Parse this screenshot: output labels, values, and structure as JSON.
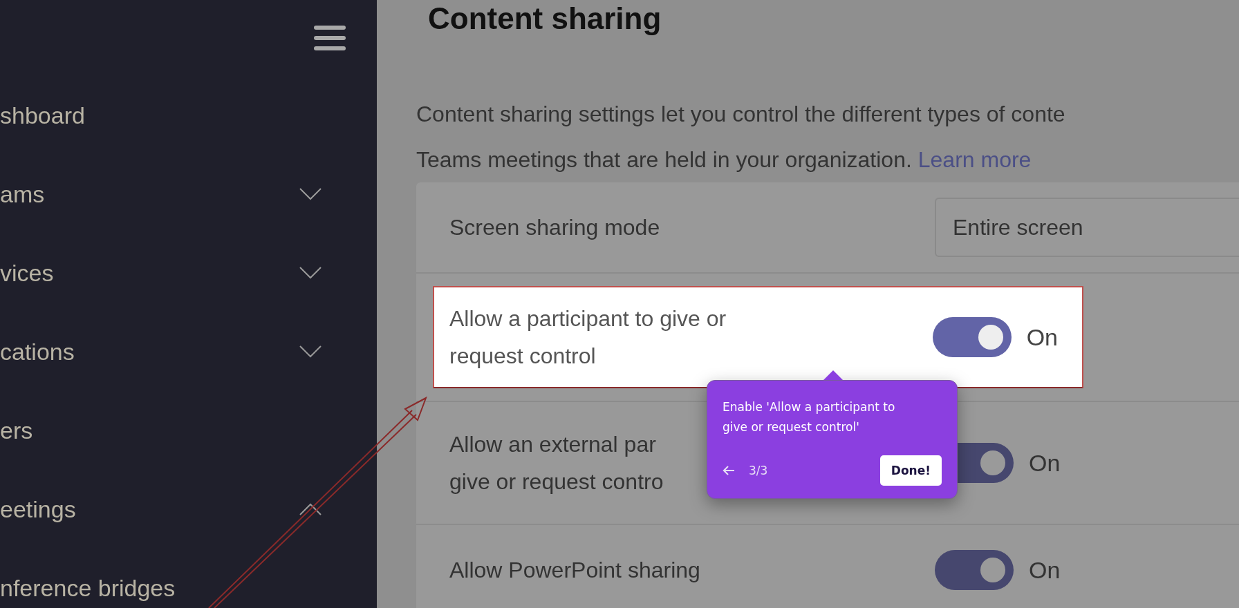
{
  "sidebar": {
    "items": [
      {
        "label": "shboard",
        "kind": "link"
      },
      {
        "label": "ams",
        "kind": "group",
        "expanded": false
      },
      {
        "label": "vices",
        "kind": "group",
        "expanded": false
      },
      {
        "label": "cations",
        "kind": "group",
        "expanded": false
      },
      {
        "label": "ers",
        "kind": "link"
      },
      {
        "label": "eetings",
        "kind": "group",
        "expanded": true
      },
      {
        "label": "nference bridges",
        "kind": "link"
      }
    ]
  },
  "page": {
    "title": "Content sharing",
    "description": "Content sharing settings let you control the different types of conte\nTeams meetings that are held in your organization.",
    "link": "Learn more"
  },
  "settings": [
    {
      "kind": "dropdown",
      "label": "Screen sharing mode",
      "value": "Entire screen",
      "highlighted": false
    },
    {
      "kind": "toggle",
      "label": "Allow a participant to give or request control",
      "on": true,
      "state": "On",
      "highlighted": true
    },
    {
      "kind": "toggle",
      "label": "Allow an external par\ngive or request contro",
      "on": true,
      "state": "On",
      "highlighted": false
    },
    {
      "kind": "toggle",
      "label": "Allow PowerPoint sharing",
      "on": true,
      "state": "On",
      "highlighted": false
    }
  ],
  "tooltip": {
    "text": "Enable 'Allow a participant to give or request control'",
    "counter": "3/3",
    "button": "Done!"
  }
}
